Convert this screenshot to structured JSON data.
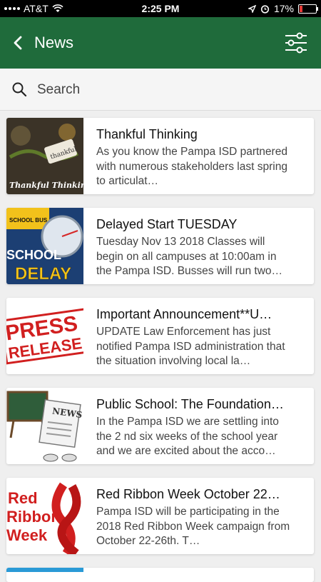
{
  "status_bar": {
    "carrier": "AT&T",
    "time": "2:25 PM",
    "battery_percent": "17%",
    "battery_level": 0.17
  },
  "header": {
    "title": "News",
    "accent_color": "#1f6b3b"
  },
  "search": {
    "placeholder": "Search",
    "value": ""
  },
  "news": [
    {
      "title": "Thankful Thinking",
      "snippet": "As you know the Pampa ISD partnered with numerous stakeholders last spring to articulat…",
      "thumb_text": "Thankful Thinking",
      "thumb_tag": "thankful"
    },
    {
      "title": "Delayed Start TUESDAY",
      "snippet": "Tuesday Nov 13 2018 Classes will begin on all campuses at 10:00am in the Pampa ISD. Busses will run two…",
      "thumb_text_1": "SCHOOL",
      "thumb_text_2": "DELAY",
      "thumb_bus": "SCHOOL BUS"
    },
    {
      "title": "Important Announcement**U…",
      "snippet": "UPDATE Law Enforcement has just notified Pampa ISD administration that the situation involving local la…",
      "thumb_text_1": "PRESS",
      "thumb_text_2": "RELEASE"
    },
    {
      "title": "Public School:  The Foundation…",
      "snippet": "In the Pampa ISD we are settling into the 2 nd six weeks of the school year and we are excited about the acco…",
      "thumb_text": "NEWS"
    },
    {
      "title": "Red Ribbon Week October 22…",
      "snippet": "Pampa ISD will be participating in the 2018 Red Ribbon Week campaign from October 22-26th. T…",
      "thumb_text_1": "Red",
      "thumb_text_2": "Ribbon",
      "thumb_text_3": "Week"
    }
  ]
}
